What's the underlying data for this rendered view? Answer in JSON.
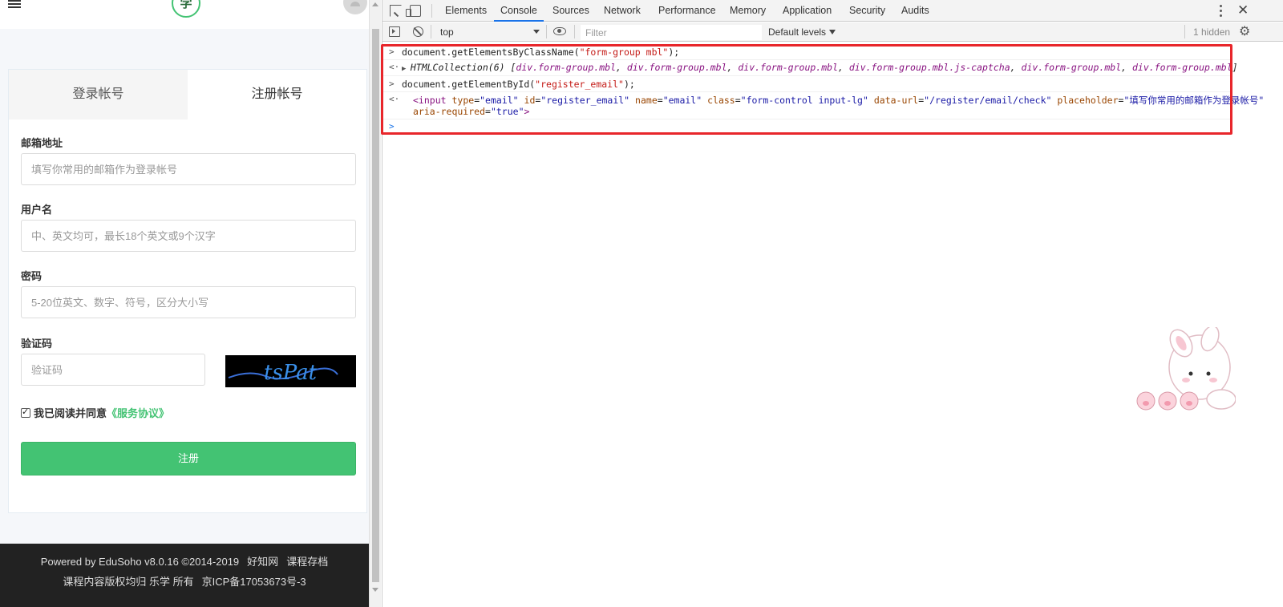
{
  "page": {
    "logo_text": "学",
    "tabs": [
      "登录帐号",
      "注册帐号"
    ],
    "form": {
      "email_label": "邮箱地址",
      "email_placeholder": "填写你常用的邮箱作为登录帐号",
      "username_label": "用户名",
      "username_placeholder": "中、英文均可，最长18个英文或9个汉字",
      "password_label": "密码",
      "password_placeholder": "5-20位英文、数字、符号，区分大小写",
      "captcha_label": "验证码",
      "captcha_placeholder": "验证码",
      "captcha_image_text": "tsPat",
      "agree_text": "我已阅读并同意",
      "agree_link": "《服务协议》",
      "submit_label": "注册"
    },
    "footer": {
      "powered": "Powered by EduSoho v8.0.16 ©2014-2019",
      "link1": "好知网",
      "link2": "课程存档",
      "copyright": "课程内容版权均归 乐学 所有",
      "icp": "京ICP备17053673号-3"
    }
  },
  "devtools": {
    "tabs": [
      "Elements",
      "Console",
      "Sources",
      "Network",
      "Performance",
      "Memory",
      "Application",
      "Security",
      "Audits"
    ],
    "active_tab": "Console",
    "context": "top",
    "filter_placeholder": "Filter",
    "levels": "Default levels",
    "hidden": "1 hidden",
    "console": {
      "cmd1_pre": "document.getElementsByClassName(",
      "cmd1_str": "\"form-group mbl\"",
      "cmd1_post": ");",
      "res1_pre": "HTMLCollection(6) [",
      "res1_items": [
        "div.form-group.mbl",
        "div.form-group.mbl",
        "div.form-group.mbl",
        "div.form-group.mbl.js-captcha",
        "div.form-group.mbl",
        "div.form-group.mbl"
      ],
      "res1_post": "]",
      "cmd2_pre": "document.getElementById(",
      "cmd2_str": "\"register_email\"",
      "cmd2_post": ");",
      "res2_tag": "<input",
      "res2_attrs": [
        {
          "name": "type",
          "value": "\"email\""
        },
        {
          "name": "id",
          "value": "\"register_email\""
        },
        {
          "name": "name",
          "value": "\"email\""
        },
        {
          "name": "class",
          "value": "\"form-control input-lg\""
        },
        {
          "name": "data-url",
          "value": "\"/register/email/check\""
        },
        {
          "name": "placeholder",
          "value": "\"填写你常用的邮箱作为登录帐号\""
        }
      ],
      "res2_line2_attr": "aria-required",
      "res2_line2_val": "\"true\"",
      "res2_close": ">"
    }
  },
  "colors": {
    "accent_green": "#43c373",
    "highlight_red": "#e8262b",
    "devtools_active_blue": "#1a73e8"
  }
}
